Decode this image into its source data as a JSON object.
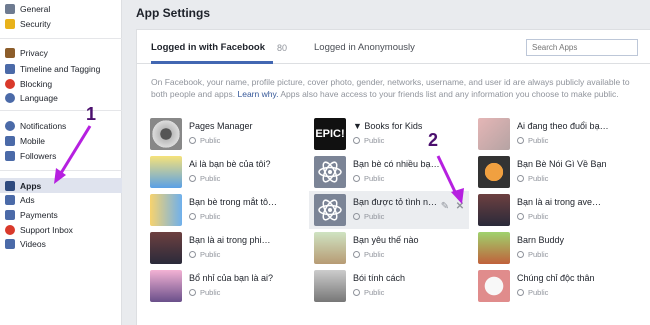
{
  "sidebar": {
    "items": [
      {
        "label": "General",
        "color": "#6e7b91"
      },
      {
        "label": "Security",
        "color": "#e8b21b"
      },
      {
        "label": "Privacy",
        "color": "#8c5d2a"
      },
      {
        "label": "Timeline and Tagging",
        "color": "#4b6aa8"
      },
      {
        "label": "Blocking",
        "color": "#d9392b"
      },
      {
        "label": "Language",
        "color": "#4b6aa8"
      },
      {
        "label": "Notifications",
        "color": "#4b6aa8"
      },
      {
        "label": "Mobile",
        "color": "#4b6aa8"
      },
      {
        "label": "Followers",
        "color": "#4b6aa8"
      },
      {
        "label": "Apps",
        "color": "#2f4a7e"
      },
      {
        "label": "Ads",
        "color": "#4b6aa8"
      },
      {
        "label": "Payments",
        "color": "#4b6aa8"
      },
      {
        "label": "Support Inbox",
        "color": "#d9392b"
      },
      {
        "label": "Videos",
        "color": "#4b6aa8"
      }
    ]
  },
  "main": {
    "title": "App Settings",
    "tabs": {
      "logged_in": "Logged in with Facebook",
      "count": "80",
      "anonymous": "Logged in Anonymously"
    },
    "search_placeholder": "Search Apps",
    "description_pre": "On Facebook, your name, profile picture, cover photo, gender, networks, username, and user id are always publicly available to both people and apps. ",
    "description_link": "Learn why.",
    "description_post": " Apps also have access to your friends list and any information you choose to make public."
  },
  "apps": [
    {
      "name": "Pages Manager",
      "privacy": "Public",
      "icon": "film-reel-icon"
    },
    {
      "name": "▼ Books for Kids",
      "privacy": "Public",
      "icon": "epic-logo-icon"
    },
    {
      "name": "Ai đang theo đuổi bạ…",
      "privacy": "Public",
      "icon": "photo-collage-icon"
    },
    {
      "name": "Ai là bạn bè của tôi?",
      "privacy": "Public",
      "icon": "people-icon"
    },
    {
      "name": "Bạn bè có nhiều bạ…",
      "privacy": "Public",
      "icon": "atom-icon"
    },
    {
      "name": "Bạn Bè Nói Gì Về Bạn",
      "privacy": "Public",
      "icon": "avatar-icon"
    },
    {
      "name": "Bạn bè trong mắt tô…",
      "privacy": "Public",
      "icon": "friends-icon"
    },
    {
      "name": "Bạn được tỏ tình n…",
      "privacy": "Public",
      "icon": "atom-icon"
    },
    {
      "name": "Bạn là ai trong ave…",
      "privacy": "Public",
      "icon": "heroes-icon"
    },
    {
      "name": "Bạn là ai trong phi…",
      "privacy": "Public",
      "icon": "heroes-icon"
    },
    {
      "name": "Bạn yêu thế nào",
      "privacy": "Public",
      "icon": "love-icon"
    },
    {
      "name": "Barn Buddy",
      "privacy": "Public",
      "icon": "barn-icon"
    },
    {
      "name": "Bổ nhỉ của bạn là ai?",
      "privacy": "Public",
      "icon": "cartoon-icon"
    },
    {
      "name": "Bói tính cách",
      "privacy": "Public",
      "icon": "photo-icon"
    },
    {
      "name": "Chúng chỉ độc thân",
      "privacy": "Public",
      "icon": "stamp-icon"
    }
  ],
  "annotations": {
    "one": "1",
    "two": "2"
  },
  "colors": {
    "accent": "#4267b2",
    "arrow": "#b620e0"
  }
}
